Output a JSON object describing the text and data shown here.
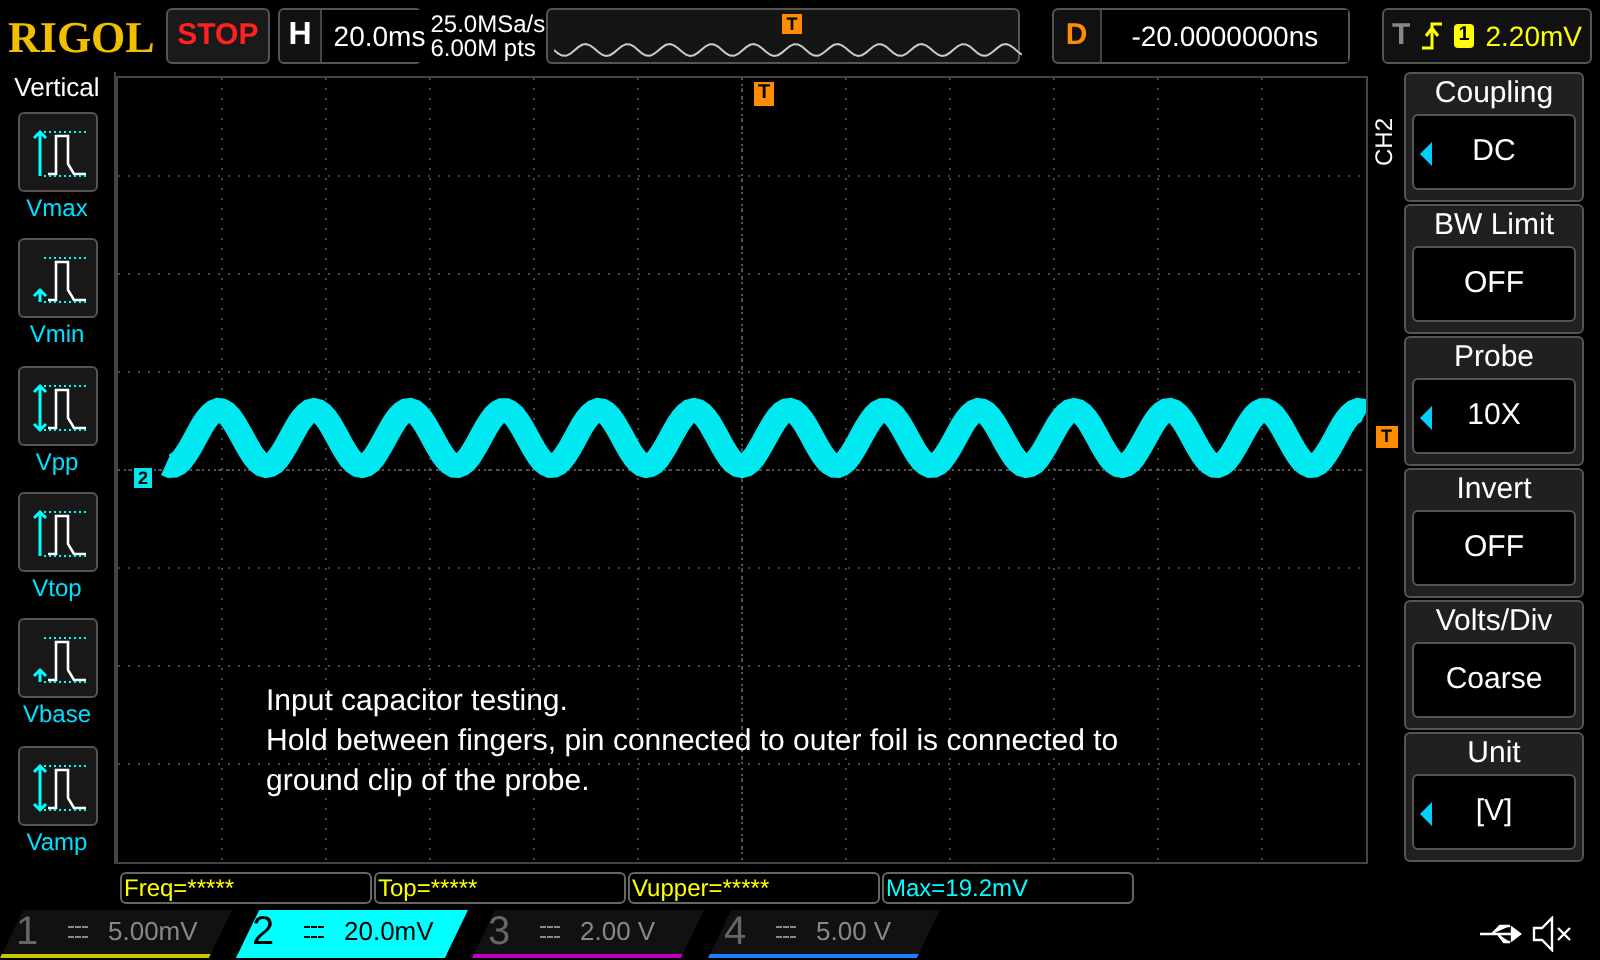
{
  "header": {
    "logo": "RIGOL",
    "run_status": "STOP",
    "timebase": {
      "label": "H",
      "value": "20.0ms"
    },
    "sample_rate": "25.0MSa/s",
    "memory_depth": "6.00M pts",
    "delay": {
      "label": "D",
      "value": "-20.0000000ns"
    },
    "trigger": {
      "label": "T",
      "channel": "1",
      "level": "2.20mV"
    },
    "overview_marker": "T"
  },
  "left_menu": {
    "title": "Vertical",
    "items": [
      {
        "label": "Vmax",
        "kind": "vmax"
      },
      {
        "label": "Vmin",
        "kind": "vmin"
      },
      {
        "label": "Vpp",
        "kind": "vpp"
      },
      {
        "label": "Vtop",
        "kind": "vtop"
      },
      {
        "label": "Vbase",
        "kind": "vbase"
      },
      {
        "label": "Vamp",
        "kind": "vamp"
      }
    ]
  },
  "screen": {
    "top_trigger_marker": "T",
    "channel_marker": "2",
    "trigger_level_marker": "T",
    "note": [
      "Input capacitor testing.",
      "Hold between fingers, pin connected to outer foil is connected to",
      "ground clip of the probe."
    ]
  },
  "right_menu": {
    "channel": "CH2",
    "items": [
      {
        "title": "Coupling",
        "value": "DC",
        "adjustable": true
      },
      {
        "title": "BW Limit",
        "value": "OFF",
        "adjustable": false
      },
      {
        "title": "Probe",
        "value": "10X",
        "adjustable": true
      },
      {
        "title": "Invert",
        "value": "OFF",
        "adjustable": false
      },
      {
        "title": "Volts/Div",
        "value": "Coarse",
        "adjustable": false
      },
      {
        "title": "Unit",
        "value": "[V]",
        "adjustable": true
      }
    ]
  },
  "measurements": [
    {
      "text": "Freq=*****",
      "color": "#ffff00"
    },
    {
      "text": "Top=*****",
      "color": "#ffff00"
    },
    {
      "text": "Vupper=*****",
      "color": "#ffff00"
    },
    {
      "text": "Max=19.2mV",
      "color": "#00ffff"
    }
  ],
  "channels": [
    {
      "number": "1",
      "scale": "5.00mV",
      "selected": false,
      "color": "#c8c800"
    },
    {
      "number": "2",
      "scale": "20.0mV",
      "selected": true,
      "color": "#00ffff"
    },
    {
      "number": "3",
      "scale": "2.00 V",
      "selected": false,
      "color": "#c000c0"
    },
    {
      "number": "4",
      "scale": "5.00 V",
      "selected": false,
      "color": "#2080ff"
    }
  ]
}
